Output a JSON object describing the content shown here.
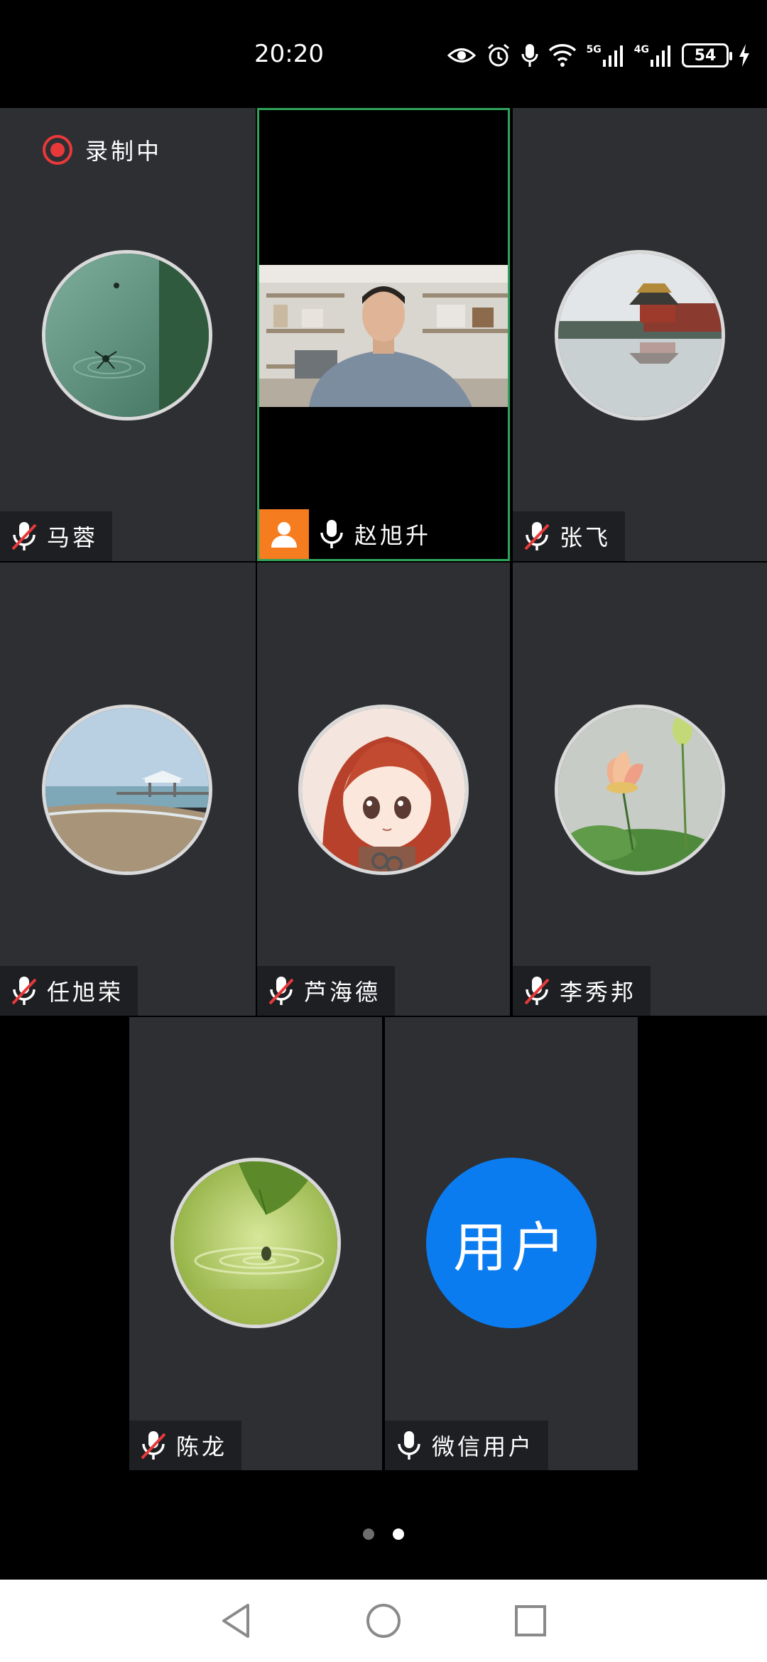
{
  "status_bar": {
    "time": "20:20",
    "network_5g": "5G",
    "network_4g": "4G",
    "battery": "54"
  },
  "meeting": {
    "recording_label": "录制中",
    "participants": [
      {
        "name": "马蓉",
        "muted": true,
        "avatar": "water-insect-photo"
      },
      {
        "name": "赵旭升",
        "muted": false,
        "host": true,
        "video": true
      },
      {
        "name": "张飞",
        "muted": true,
        "avatar": "palace-reflection-photo"
      },
      {
        "name": "任旭荣",
        "muted": true,
        "avatar": "beach-pavilion-photo"
      },
      {
        "name": "芦海德",
        "muted": true,
        "avatar": "anime-girl-avatar"
      },
      {
        "name": "李秀邦",
        "muted": true,
        "avatar": "lotus-flower-photo"
      },
      {
        "name": "陈龙",
        "muted": true,
        "avatar": "green-water-drop-photo"
      },
      {
        "name": "微信用户",
        "muted": false,
        "avatar_text": "用户"
      }
    ]
  },
  "pager": {
    "total": 2,
    "active": 2
  },
  "colors": {
    "tile_bg": "#2d2f33",
    "speaker_border": "#2ea35a",
    "host_badge": "#f57c1f",
    "record_red": "#e8393a",
    "default_avatar_blue": "#0a7cf0"
  }
}
